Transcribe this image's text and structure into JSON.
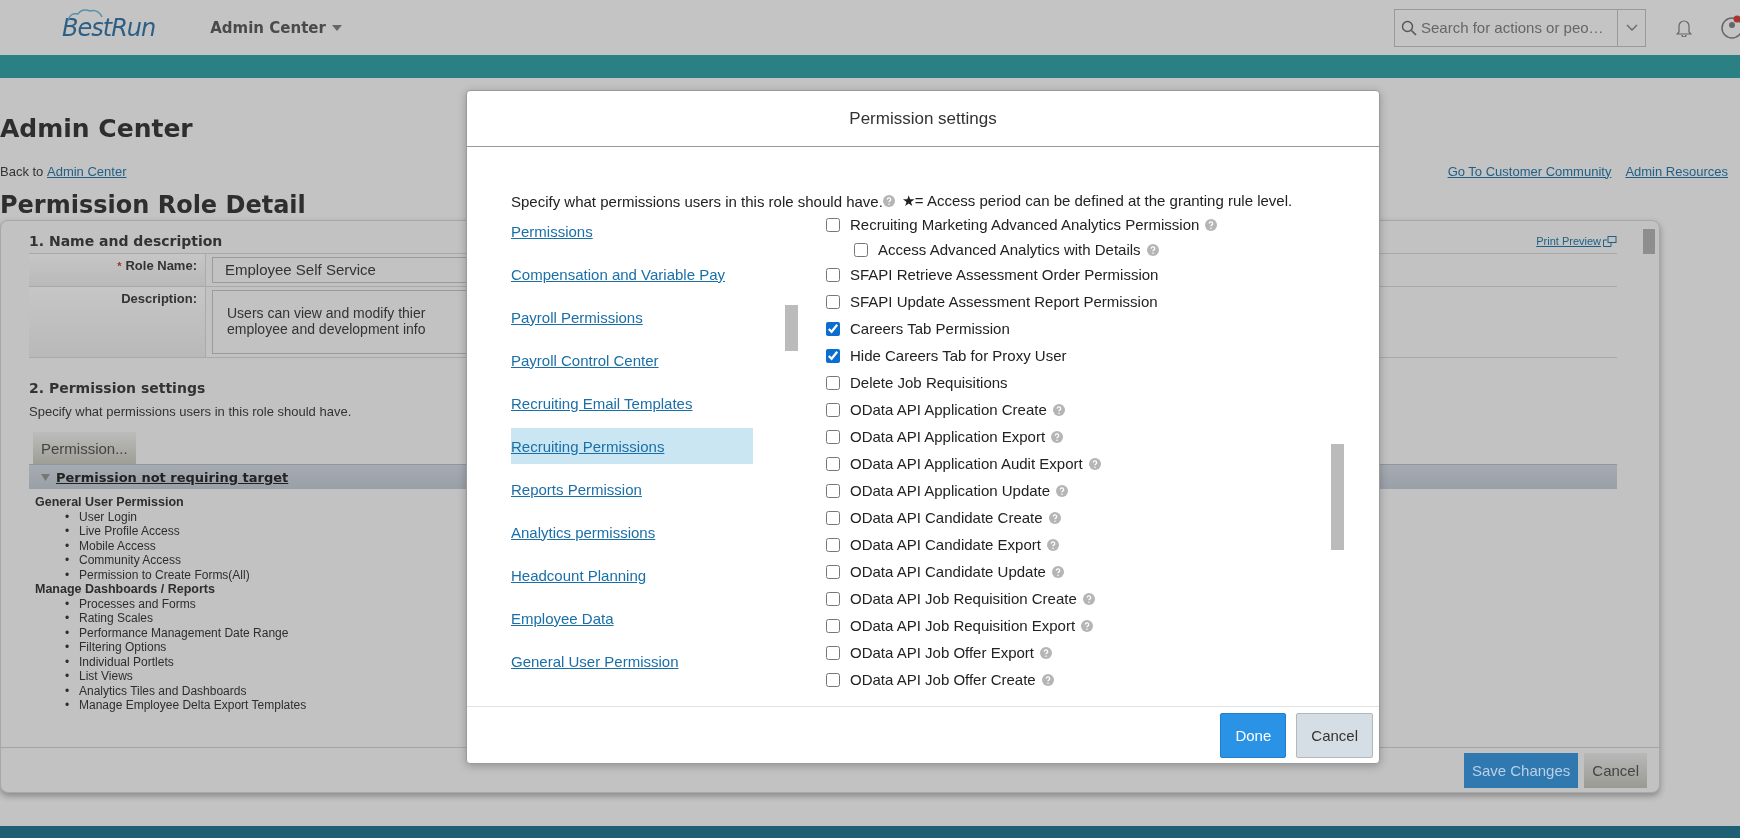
{
  "header": {
    "logo": "BestRun",
    "app_title": "Admin Center",
    "search": {
      "placeholder": "Search for actions or peo…"
    }
  },
  "page": {
    "title": "Admin Center",
    "back_prefix": "Back to",
    "back_link": "Admin Center",
    "links": [
      "Go To Customer Community",
      "Admin Resources"
    ],
    "subtitle": "Permission Role Detail",
    "section_1": {
      "title": "1. Name and description",
      "print_preview": "Print Preview",
      "fields": [
        {
          "label": "Role Name:",
          "marker": "*",
          "kind": "input",
          "value": "Employee Self Service"
        },
        {
          "label": "Description:",
          "kind": "textarea",
          "value": "Users can view and modify thier employee and development info"
        }
      ]
    },
    "section_2": {
      "title": "2. Permission settings",
      "description": "Specify what permissions users in this role should have.",
      "button": "Permission...",
      "group": {
        "title": "Permission not requiring target",
        "expanded": true
      },
      "categories": [
        {
          "name": "General User Permission",
          "bullet": "•",
          "items": [
            "User Login",
            "Live Profile Access",
            "Mobile Access",
            "Community Access",
            "Permission to Create Forms(All)"
          ]
        },
        {
          "name": "Manage Dashboards / Reports",
          "bullet": "•",
          "items": [
            "Processes and Forms",
            "Rating Scales",
            "Performance Management Date Range",
            "Filtering Options",
            "Individual Portlets",
            "List Views",
            "Analytics Tiles and Dashboards",
            "Manage Employee Delta Export Templates"
          ]
        }
      ]
    },
    "buttons": [
      "Save Changes",
      "Cancel"
    ]
  },
  "dialog": {
    "title": "Permission settings",
    "description": "Specify what permissions users in this role should have.",
    "legend": "★= Access period can be defined at the granting rule level.",
    "categories": [
      {
        "label": "Permissions",
        "selected": false
      },
      {
        "label": "Compensation and Variable Pay",
        "selected": false
      },
      {
        "label": "Payroll Permissions",
        "selected": false
      },
      {
        "label": "Payroll Control Center",
        "selected": false
      },
      {
        "label": "Recruiting Email Templates",
        "selected": false
      },
      {
        "label": "Recruiting Permissions",
        "selected": true
      },
      {
        "label": "Reports Permission",
        "selected": false
      },
      {
        "label": "Analytics permissions",
        "selected": false
      },
      {
        "label": "Headcount Planning",
        "selected": false
      },
      {
        "label": "Employee Data",
        "selected": false
      },
      {
        "label": "General User Permission",
        "selected": false
      }
    ],
    "permissions": [
      {
        "label": "Recruiting Marketing Advanced Analytics Permission",
        "checked": false,
        "help": true,
        "children": [
          {
            "label": "Access Advanced Analytics with Details",
            "checked": false,
            "help": true
          }
        ]
      },
      {
        "label": "SFAPI Retrieve Assessment Order Permission",
        "checked": false,
        "help": false
      },
      {
        "label": "SFAPI Update Assessment Report Permission",
        "checked": false,
        "help": false
      },
      {
        "label": "Careers Tab Permission",
        "checked": true,
        "help": false
      },
      {
        "label": "Hide Careers Tab for Proxy User",
        "checked": true,
        "help": false
      },
      {
        "label": "Delete Job Requisitions",
        "checked": false,
        "help": false
      },
      {
        "label": "OData API Application Create",
        "checked": false,
        "help": true
      },
      {
        "label": "OData API Application Export",
        "checked": false,
        "help": true
      },
      {
        "label": "OData API Application Audit Export",
        "checked": false,
        "help": true
      },
      {
        "label": "OData API Application Update",
        "checked": false,
        "help": true
      },
      {
        "label": "OData API Candidate Create",
        "checked": false,
        "help": true
      },
      {
        "label": "OData API Candidate Export",
        "checked": false,
        "help": true
      },
      {
        "label": "OData API Candidate Update",
        "checked": false,
        "help": true
      },
      {
        "label": "OData API Job Requisition Create",
        "checked": false,
        "help": true
      },
      {
        "label": "OData API Job Requisition Export",
        "checked": false,
        "help": true
      },
      {
        "label": "OData API Job Offer Export",
        "checked": false,
        "help": true
      },
      {
        "label": "OData API Job Offer Create",
        "checked": false,
        "help": true
      }
    ],
    "buttons": [
      {
        "label": "Done",
        "kind": "primary"
      },
      {
        "label": "Cancel",
        "kind": "secondary"
      }
    ]
  }
}
